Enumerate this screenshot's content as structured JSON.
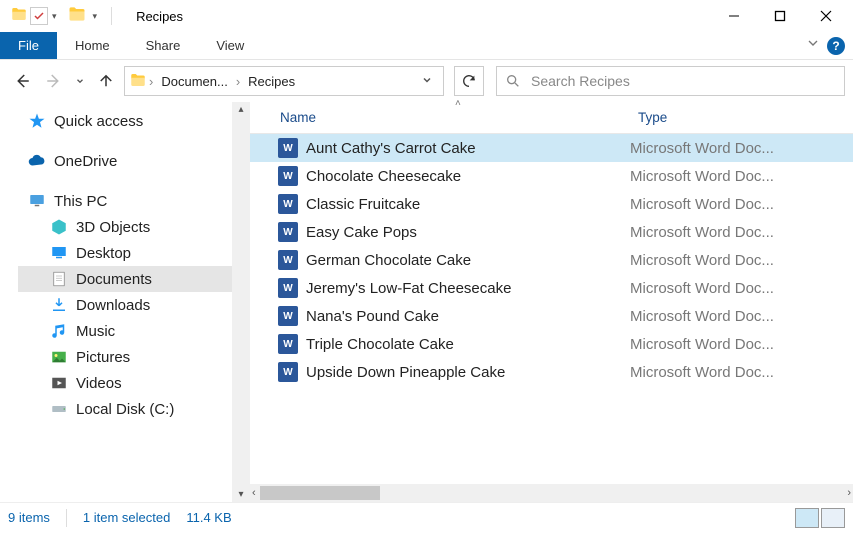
{
  "window": {
    "title": "Recipes"
  },
  "ribbon": {
    "file": "File",
    "tabs": [
      "Home",
      "Share",
      "View"
    ]
  },
  "breadcrumb": [
    "Documen...",
    "Recipes"
  ],
  "search": {
    "placeholder": "Search Recipes"
  },
  "sidebar": {
    "quick_access": "Quick access",
    "onedrive": "OneDrive",
    "this_pc": "This PC",
    "items": [
      {
        "label": "3D Objects"
      },
      {
        "label": "Desktop"
      },
      {
        "label": "Documents",
        "selected": true
      },
      {
        "label": "Downloads"
      },
      {
        "label": "Music"
      },
      {
        "label": "Pictures"
      },
      {
        "label": "Videos"
      },
      {
        "label": "Local Disk (C:)"
      }
    ]
  },
  "columns": {
    "name": "Name",
    "type": "Type"
  },
  "files": [
    {
      "name": "Aunt Cathy's Carrot Cake",
      "type": "Microsoft Word Doc...",
      "selected": true
    },
    {
      "name": "Chocolate Cheesecake",
      "type": "Microsoft Word Doc..."
    },
    {
      "name": "Classic Fruitcake",
      "type": "Microsoft Word Doc..."
    },
    {
      "name": "Easy Cake Pops",
      "type": "Microsoft Word Doc..."
    },
    {
      "name": "German Chocolate Cake",
      "type": "Microsoft Word Doc..."
    },
    {
      "name": "Jeremy's Low-Fat Cheesecake",
      "type": "Microsoft Word Doc..."
    },
    {
      "name": "Nana's Pound Cake",
      "type": "Microsoft Word Doc..."
    },
    {
      "name": "Triple Chocolate Cake",
      "type": "Microsoft Word Doc..."
    },
    {
      "name": "Upside Down Pineapple Cake",
      "type": "Microsoft Word Doc..."
    }
  ],
  "status": {
    "count": "9 items",
    "selected": "1 item selected",
    "size": "11.4 KB"
  }
}
